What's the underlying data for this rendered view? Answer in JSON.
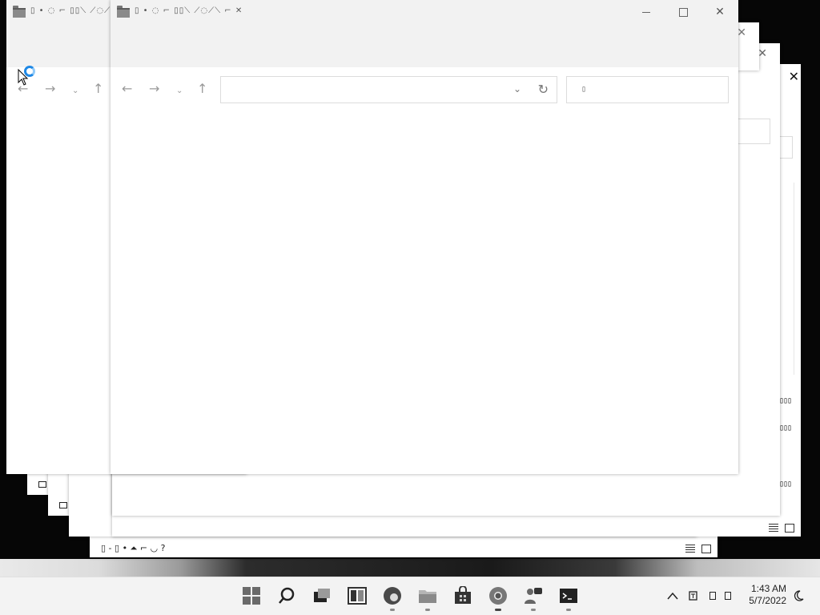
{
  "main_window": {
    "title": "▯ • ◌ ⌐ ▯▯⟍  ⟋◌⟋⟍ ⌐ ✕",
    "minimize_glyph": "",
    "maximize_glyph": "",
    "close_glyph": "✕",
    "back_glyph": "←",
    "forward_glyph": "→",
    "recent_glyph": "⌄",
    "up_glyph": "↑",
    "address_value": "",
    "address_dropdown_glyph": "⌄",
    "refresh_glyph": "↻",
    "search_placeholder": "▯"
  },
  "back_window": {
    "title": "▯ • ◌ ⌐ ▯▯⟍  ⟋◌⟋"
  },
  "background_windows": {
    "close_glyph": "✕",
    "pipes_glyph": "▯▯▯",
    "bottom_bar_text": "▯ - ▯ • ⏶ ⌐ ◡ ?"
  },
  "taskbar": {
    "items": [
      {
        "name": "start",
        "icon": "windows-logo-icon"
      },
      {
        "name": "search",
        "icon": "search-icon"
      },
      {
        "name": "task-view",
        "icon": "task-view-icon"
      },
      {
        "name": "widgets",
        "icon": "widgets-icon"
      },
      {
        "name": "edge",
        "icon": "edge-browser-icon"
      },
      {
        "name": "file-explorer",
        "icon": "folder-icon"
      },
      {
        "name": "store",
        "icon": "store-icon"
      },
      {
        "name": "chrome",
        "icon": "chrome-icon"
      },
      {
        "name": "teams",
        "icon": "teams-chat-icon"
      },
      {
        "name": "terminal",
        "icon": "terminal-icon"
      }
    ],
    "tray": {
      "chevron": "^",
      "time": "1:43 AM",
      "date": "5/7/2022"
    }
  },
  "colors": {
    "accent": "#1e88e5",
    "titlebar": "#f2f2f2",
    "taskbar": "#f3f3f3"
  }
}
